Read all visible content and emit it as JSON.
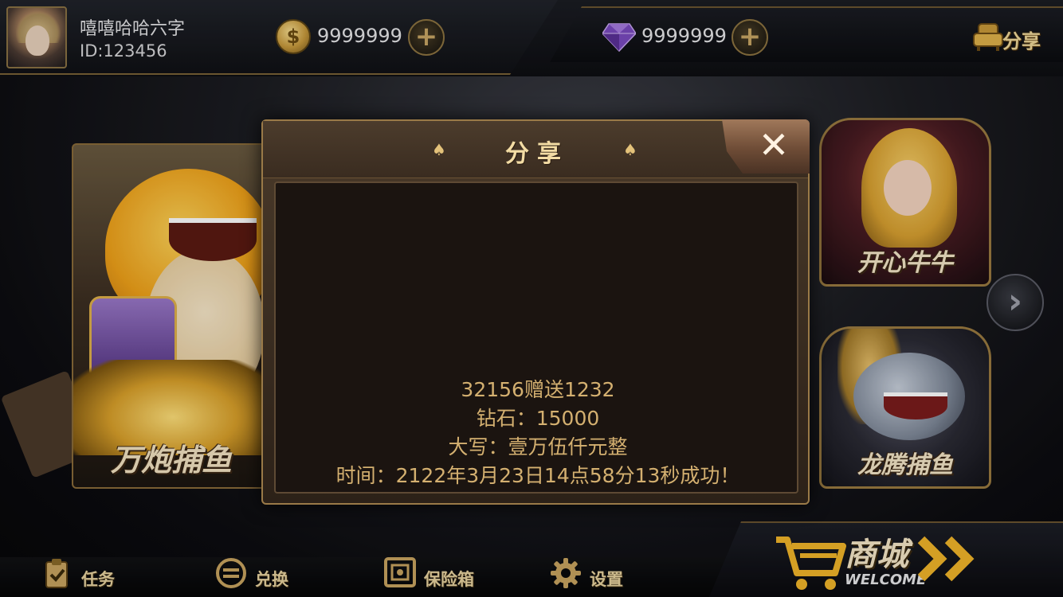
{
  "user": {
    "name": "嘻嘻哈哈六字",
    "id_text": "ID:123456"
  },
  "currency": {
    "gold": "9999999",
    "diamond": "9999999"
  },
  "share_button": {
    "label": "分享"
  },
  "games": {
    "left": {
      "title": "万炮捕鱼"
    },
    "right_top": {
      "title": "开心牛牛"
    },
    "right_bottom": {
      "title": "龙腾捕鱼"
    }
  },
  "modal": {
    "title": "分享",
    "close_symbol": "✕",
    "lines": [
      "32156赠送1232",
      "钻石：15000",
      "大写：壹万伍仟元整",
      "时间：2122年3月23日14点58分13秒成功！"
    ]
  },
  "bottom_nav": {
    "tasks": "任务",
    "exchange": "兑换",
    "safe": "保险箱",
    "settings": "设置"
  },
  "shop": {
    "label": "商城",
    "sub": "WELCOME"
  },
  "icons": {
    "gold": "coin-icon",
    "diamond": "diamond-icon",
    "share": "sofa-icon",
    "next": "chevron-right-icon",
    "tasks": "clipboard-check-icon",
    "exchange": "exchange-icon",
    "safe": "safe-icon",
    "settings": "gear-icon",
    "shop": "cart-icon"
  },
  "colors": {
    "gold_text": "#d4b070",
    "title_text": "#f3dca4",
    "panel_border": "#9a7a48",
    "accent_purple": "#8a5ad0"
  }
}
